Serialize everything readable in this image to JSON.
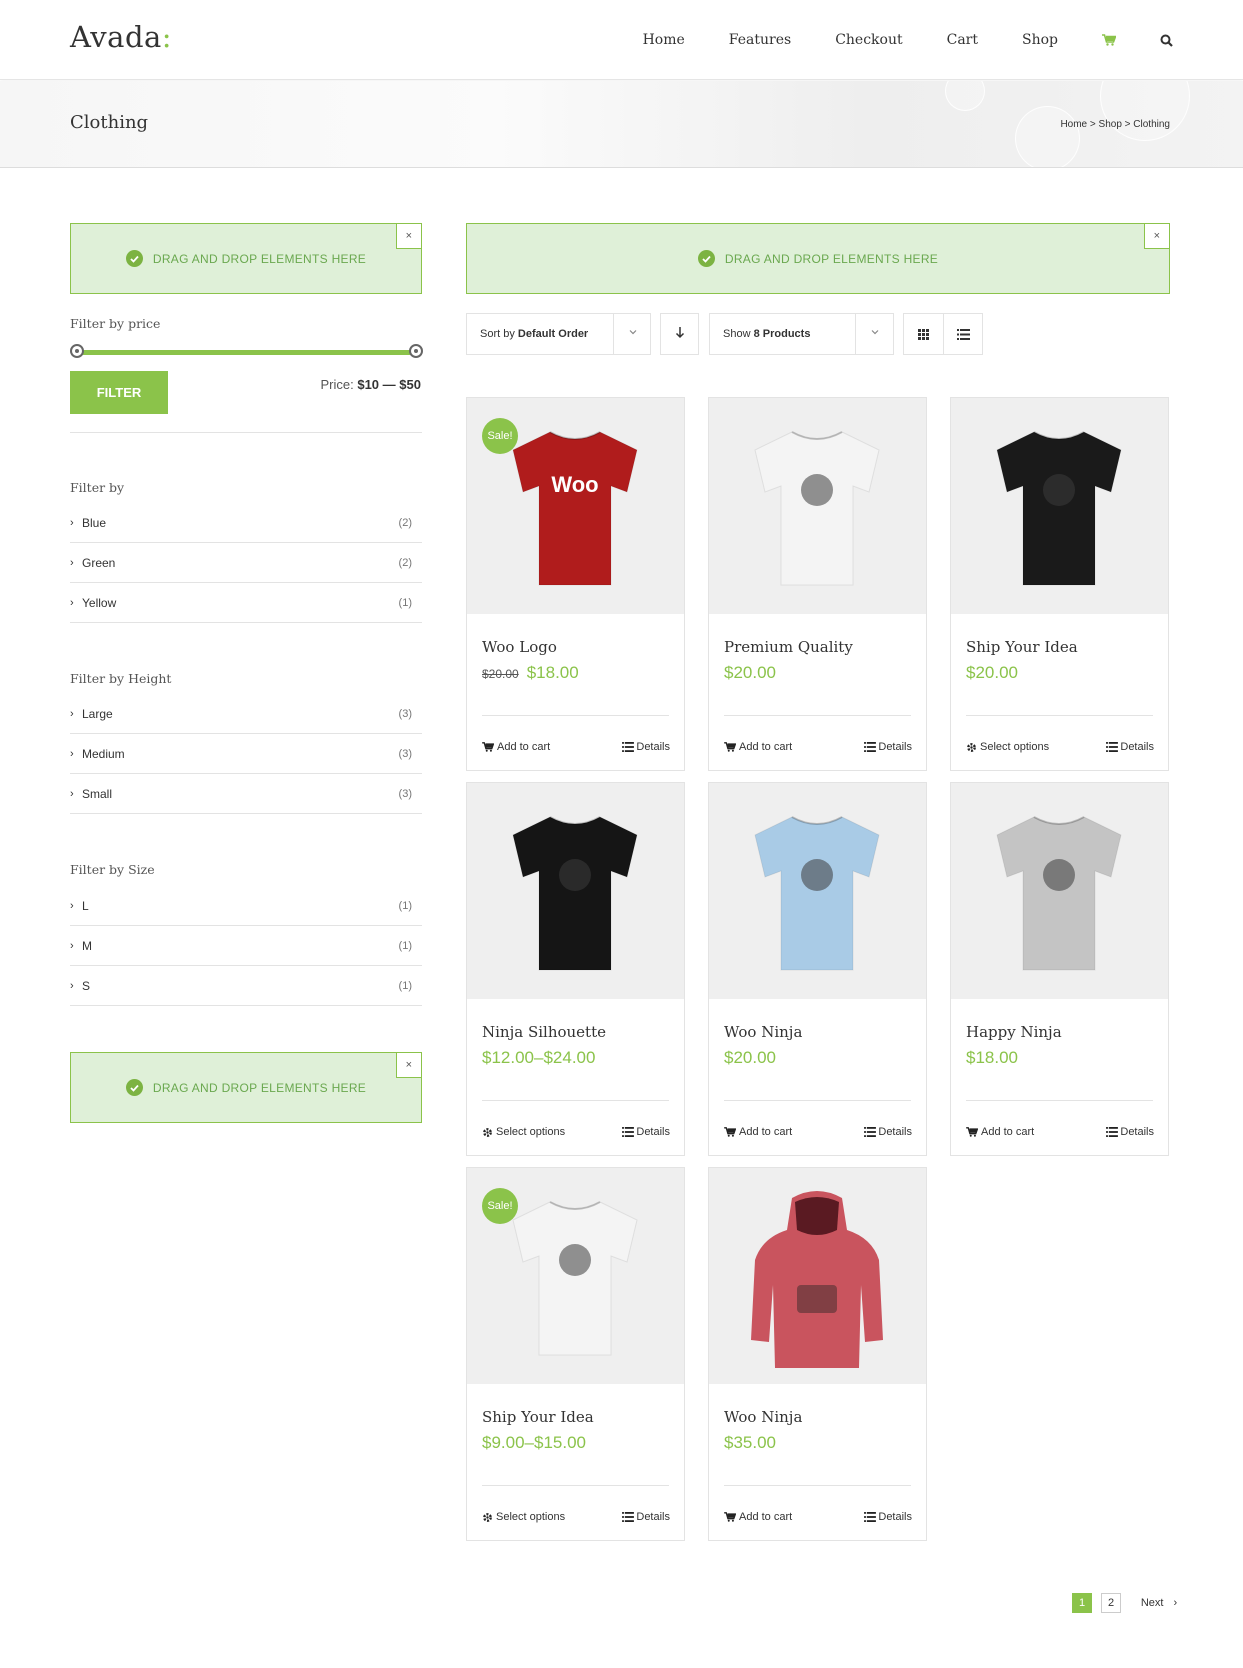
{
  "brand": {
    "logo_main": "Avada",
    "logo_accent": ":",
    "accent_color": "#8bc34a"
  },
  "nav": {
    "items": [
      "Home",
      "Features",
      "Checkout",
      "Cart",
      "Shop"
    ],
    "cart_icon": "cart-icon",
    "search_icon": "search-icon"
  },
  "page": {
    "title": "Clothing",
    "breadcrumb": [
      "Home",
      "Shop",
      "Clothing"
    ],
    "breadcrumb_sep": ">"
  },
  "dropzone": {
    "label": "DRAG AND DROP ELEMENTS HERE",
    "close": "×"
  },
  "sidebar": {
    "price_filter": {
      "heading": "Filter by price",
      "button": "FILTER",
      "price_prefix": "Price:",
      "min": "$10",
      "dash": "—",
      "max": "$50"
    },
    "filter_by": {
      "heading": "Filter by",
      "items": [
        {
          "label": "Blue",
          "count": "(2)"
        },
        {
          "label": "Green",
          "count": "(2)"
        },
        {
          "label": "Yellow",
          "count": "(1)"
        }
      ]
    },
    "filter_height": {
      "heading": "Filter by Height",
      "items": [
        {
          "label": "Large",
          "count": "(3)"
        },
        {
          "label": "Medium",
          "count": "(3)"
        },
        {
          "label": "Small",
          "count": "(3)"
        }
      ]
    },
    "filter_size": {
      "heading": "Filter by Size",
      "items": [
        {
          "label": "L",
          "count": "(1)"
        },
        {
          "label": "M",
          "count": "(1)"
        },
        {
          "label": "S",
          "count": "(1)"
        }
      ]
    }
  },
  "toolbar": {
    "sort_prefix": "Sort by",
    "sort_value": "Default Order",
    "show_prefix": "Show",
    "show_value": "8 Products"
  },
  "products": [
    {
      "name": "Woo Logo",
      "old_price": "$20.00",
      "price": "$18.00",
      "sale": "Sale!",
      "action": "Add to cart",
      "details": "Details",
      "shirt_color": "#b01c1c",
      "print": "Woo"
    },
    {
      "name": "Premium Quality",
      "price": "$20.00",
      "action": "Add to cart",
      "details": "Details",
      "shirt_color": "#f4f4f4"
    },
    {
      "name": "Ship Your Idea",
      "price": "$20.00",
      "action": "Select options",
      "details": "Details",
      "shirt_color": "#1a1a1a"
    },
    {
      "name": "Ninja Silhouette",
      "price_low": "$12.00",
      "price_high": "$24.00",
      "price_sep": "–",
      "action": "Select options",
      "details": "Details",
      "shirt_color": "#151515"
    },
    {
      "name": "Woo Ninja",
      "price": "$20.00",
      "action": "Add to cart",
      "details": "Details",
      "shirt_color": "#a9cbe6"
    },
    {
      "name": "Happy Ninja",
      "price": "$18.00",
      "action": "Add to cart",
      "details": "Details",
      "shirt_color": "#c4c4c4"
    },
    {
      "name": "Ship Your Idea",
      "price_low": "$9.00",
      "price_high": "$15.00",
      "price_sep": "–",
      "sale": "Sale!",
      "action": "Select options",
      "details": "Details",
      "shirt_color": "#f4f4f4"
    },
    {
      "name": "Woo Ninja",
      "price": "$35.00",
      "action": "Add to cart",
      "details": "Details",
      "shirt_color": "#c9545e"
    }
  ],
  "pagination": {
    "pages": [
      "1",
      "2"
    ],
    "current": "1",
    "next": "Next"
  }
}
